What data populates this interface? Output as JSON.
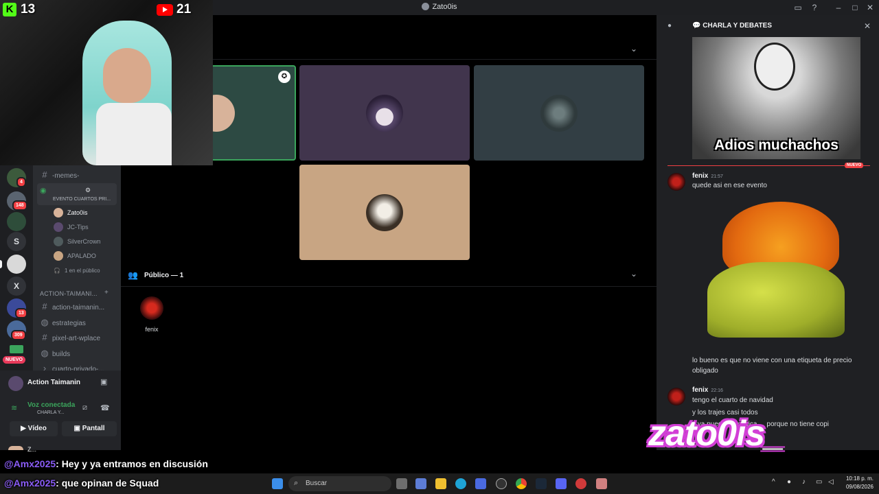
{
  "window": {
    "title": "Zato0is"
  },
  "overlay": {
    "kick_count": "13",
    "youtube_count": "21"
  },
  "server_rail": {
    "badges": [
      "4",
      "148",
      "13",
      "309"
    ],
    "letters": [
      "S",
      "X"
    ],
    "nuevo": "NUEVO"
  },
  "sidebar": {
    "memes_channel": "-memes-",
    "event_label": "EVENTO CUARTOS PRI...",
    "voice_users": [
      "Zato0is",
      "JC-Tips",
      "SilverCrown",
      "APALADO"
    ],
    "audience": "1 en el público",
    "category": "ACTION-TAIMANI...",
    "channels": [
      "action-taimanin...",
      "estrategias",
      "pixel-art-wplace",
      "builds",
      "cuarto-privado-..."
    ]
  },
  "user_panel": {
    "server_name": "Action Taimanin",
    "voice_status": "Voz conectada",
    "voice_channel": "CHARLA Y...",
    "video_btn": "Vídeo",
    "screen_btn": "Pantall",
    "username": "Z..."
  },
  "stage": {
    "audience_header": "Público — 1",
    "audience_member": "fenix"
  },
  "chat": {
    "channel_title": "CHARLA Y DEBATES",
    "meme_caption": "Adios muchachos",
    "new_label": "NUEVO",
    "messages": [
      {
        "name": "fenix",
        "time": "21:57",
        "text": "quede asi en ese evento"
      },
      {
        "text": "lo bueno es que no viene con una etiqueta de precio obligado"
      },
      {
        "name": "fenix",
        "time": "22:16",
        "text": "tengo el cuarto de navidad"
      },
      {
        "text": "y los trajes casi todos"
      },
      {
        "text": "y ya puedo ... musica ... porque no tiene copi"
      }
    ]
  },
  "stream_chat": [
    {
      "user": "@Amx2025",
      "text": ": Hey y ya entramos en discusión"
    },
    {
      "user": "@Amx2025",
      "text": ": que opinan de Squad"
    }
  ],
  "watermark": "zato0is_",
  "taskbar": {
    "search": "Buscar",
    "time": "10:18 p. m.",
    "date": "09/08/2026"
  }
}
